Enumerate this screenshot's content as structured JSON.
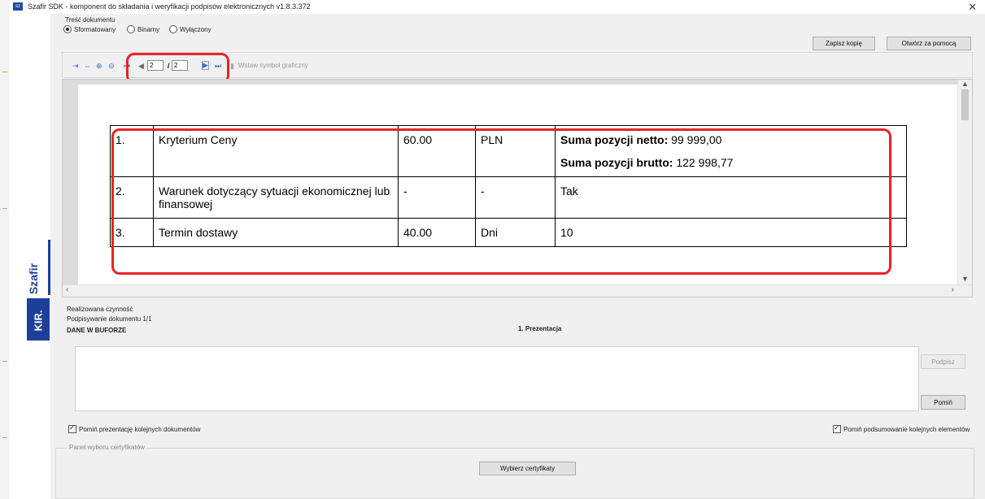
{
  "window": {
    "title": "Szafir SDK - komponent do składania i weryfikacji podpisów elektronicznych v1.8.3.372",
    "close_glyph": "✕",
    "app_icon_text": "sz"
  },
  "brand": {
    "name": "Szafir",
    "logo": "KIR."
  },
  "content": {
    "label": "Treść dokumentu",
    "modes": [
      {
        "label": "Sformatowany",
        "selected": true
      },
      {
        "label": "Binarny",
        "selected": false
      },
      {
        "label": "Wyłączony",
        "selected": false
      }
    ],
    "save_copy_label": "Zapisz kopię",
    "open_with_label": "Otwórz za pomocą"
  },
  "toolbar": {
    "page_current": "2",
    "page_separator": "/",
    "page_total": "2",
    "insert_symbol_label": "Wstaw symbol graficzny",
    "icons": [
      "fit-width-icon",
      "fit-page-icon",
      "zoom-in-icon",
      "zoom-out-icon",
      "first-page-icon",
      "prev-page-icon",
      "next-page-icon",
      "last-page-icon",
      "insert-symbol-icon"
    ]
  },
  "document": {
    "rows": [
      {
        "no": "1.",
        "criterion": "Kryterium Ceny",
        "weight": "60.00",
        "unit": "PLN",
        "value_parts": [
          {
            "label": "Suma pozycji netto:",
            "value": " 99 999,00"
          },
          {
            "label": "Suma pozycji brutto:",
            "value": " 122 998,77"
          }
        ]
      },
      {
        "no": "2.",
        "criterion": "Warunek dotyczący sytuacji ekonomicznej lub finansowej",
        "weight": "-",
        "unit": "-",
        "value": "Tak"
      },
      {
        "no": "3.",
        "criterion": "Termin dostawy",
        "weight": "40.00",
        "unit": "Dni",
        "value": "10"
      }
    ]
  },
  "activity": {
    "label": "Realizowana czynność",
    "progress": "Podpisywanie dokumentu 1/1",
    "buffer": "DANE W BUFORZE",
    "presentation": "1. Prezentacja",
    "sign_label": "Podpisz",
    "skip_label": "Pomiń"
  },
  "options": {
    "skip_presentation_label": "Pomiń prezentację kolejnych dokumentów",
    "skip_presentation_checked": true,
    "skip_summary_label": "Pomiń podsumowanie kolejnych elementów",
    "skip_summary_checked": true
  },
  "certificates": {
    "label": "Panel wyboru certyfikatów",
    "choose_label": "Wybierz certyfikaty"
  },
  "colors": {
    "highlight": "#e8232b",
    "brand": "#1d3f9a"
  }
}
